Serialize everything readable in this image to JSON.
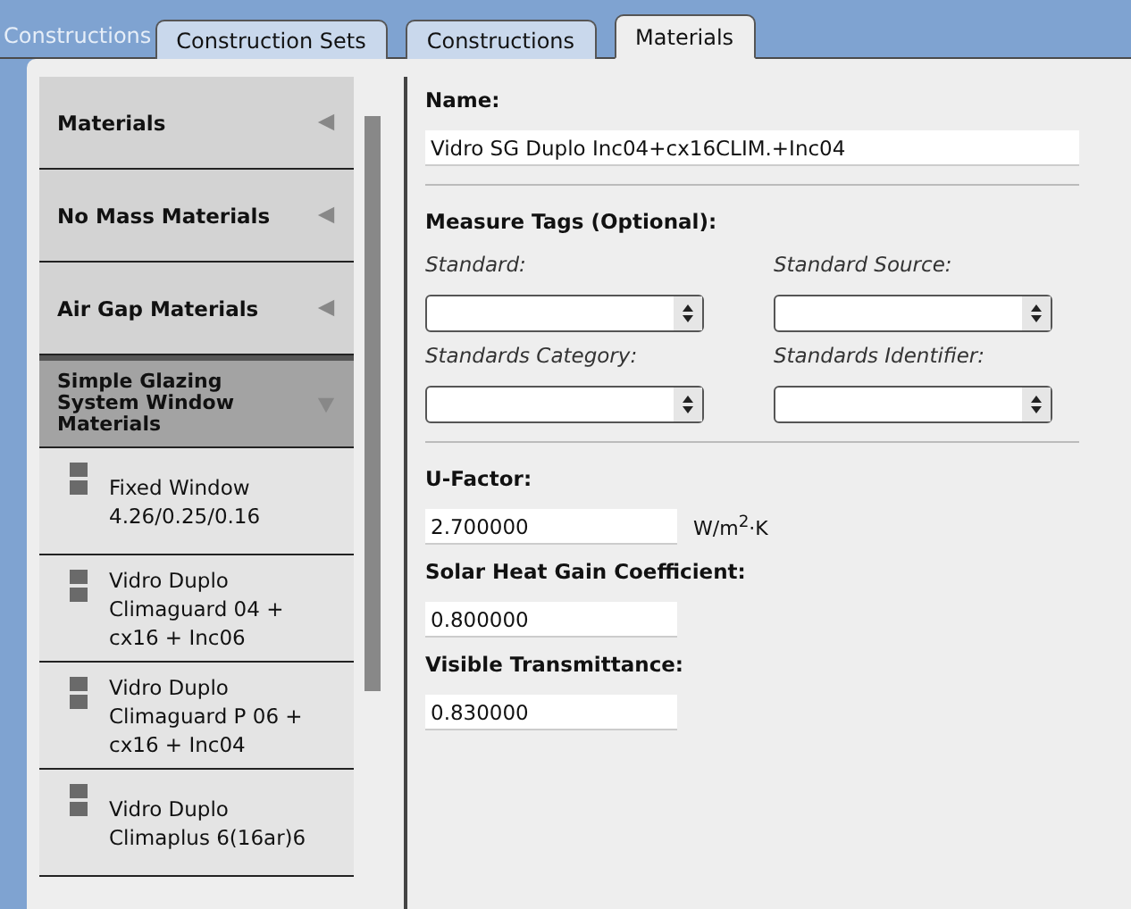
{
  "header": {
    "title": "Constructions"
  },
  "tabs": [
    {
      "label": "Construction Sets",
      "selected": false
    },
    {
      "label": "Constructions",
      "selected": false
    },
    {
      "label": "Materials",
      "selected": true
    }
  ],
  "sidebar": {
    "groups": [
      {
        "label": "Materials",
        "expanded": false
      },
      {
        "label": "No Mass Materials",
        "expanded": false
      },
      {
        "label": "Air Gap Materials",
        "expanded": false
      },
      {
        "label": "Simple Glazing System Window Materials",
        "expanded": true,
        "items": [
          {
            "label": "Fixed Window 4.26/0.25/0.16"
          },
          {
            "label": "Vidro Duplo Climaguard 04 + cx16 + Inc06"
          },
          {
            "label": "Vidro Duplo Climaguard P 06 + cx16 + Inc04"
          },
          {
            "label": "Vidro Duplo Climaplus 6(16ar)6"
          }
        ]
      }
    ]
  },
  "form": {
    "name_label": "Name:",
    "name_value": "Vidro SG Duplo Inc04+cx16CLIM.+Inc04",
    "measure_tags_label": "Measure Tags (Optional):",
    "tags": [
      {
        "label": "Standard:"
      },
      {
        "label": "Standard Source:"
      },
      {
        "label": "Standards Category:"
      },
      {
        "label": "Standards Identifier:"
      }
    ],
    "fields": [
      {
        "label": "U-Factor:",
        "value": "2.700000",
        "unit": "W/m$^{2}$·K"
      },
      {
        "label": "Solar Heat Gain Coefficient:",
        "value": "0.800000"
      },
      {
        "label": "Visible Transmittance:",
        "value": "0.830000"
      }
    ]
  }
}
